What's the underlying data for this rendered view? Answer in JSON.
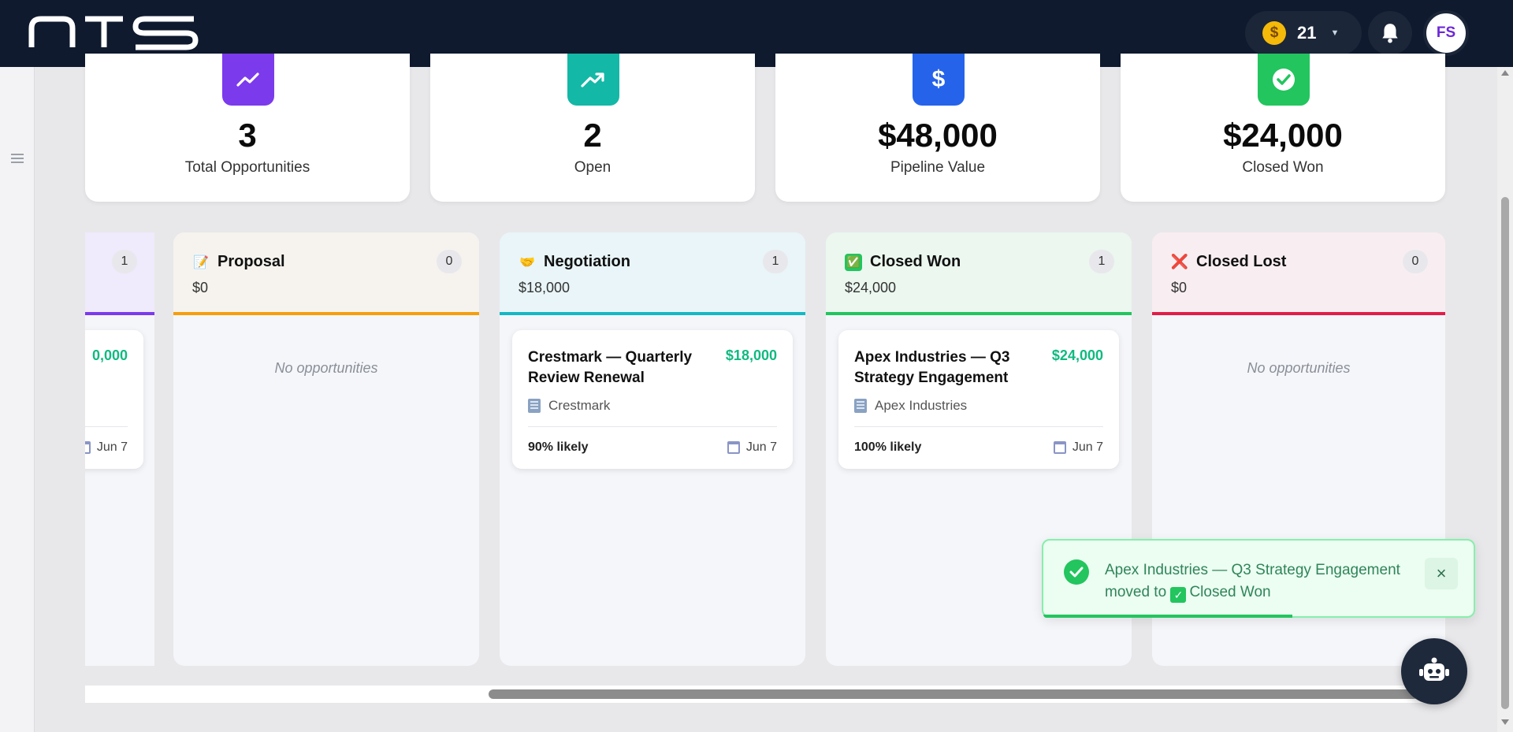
{
  "header": {
    "logo_text": "NTS",
    "credits": "21",
    "avatar_initials": "FS"
  },
  "stats": [
    {
      "value": "3",
      "label": "Total Opportunities",
      "color": "#7c3aed",
      "icon": "trending-up-icon"
    },
    {
      "value": "2",
      "label": "Open",
      "color": "#14b8a6",
      "icon": "trending-up-icon"
    },
    {
      "value": "$48,000",
      "label": "Pipeline Value",
      "color": "#2563eb",
      "icon": "dollar-icon"
    },
    {
      "value": "$24,000",
      "label": "Closed Won",
      "color": "#22c55e",
      "icon": "check-circle-icon"
    }
  ],
  "pipeline": {
    "partial_column": {
      "count": "1",
      "card_amount": "0,000",
      "card_date": "Jun 7",
      "color": "#7c3aed"
    },
    "columns": [
      {
        "name": "Proposal",
        "emoji": "📝",
        "total": "$0",
        "count": "0",
        "color": "#f59e0b",
        "head_bg": "#f6f3ee",
        "empty_text": "No opportunities"
      },
      {
        "name": "Negotiation",
        "emoji": "🤝",
        "total": "$18,000",
        "count": "1",
        "color": "#14b8c4",
        "head_bg": "#e9f5f8",
        "card": {
          "title": "Crestmark — Quarterly Review Renewal",
          "amount": "$18,000",
          "company": "Crestmark",
          "likely": "90% likely",
          "date": "Jun 7"
        }
      },
      {
        "name": "Closed Won",
        "emoji": "✅",
        "total": "$24,000",
        "count": "1",
        "color": "#22c55e",
        "head_bg": "#ebf7ef",
        "card": {
          "title": "Apex Industries — Q3 Strategy Engagement",
          "amount": "$24,000",
          "company": "Apex Industries",
          "likely": "100% likely",
          "date": "Jun 7"
        }
      },
      {
        "name": "Closed Lost",
        "emoji": "❌",
        "total": "$0",
        "count": "0",
        "color": "#e11d48",
        "head_bg": "#f8eef1",
        "empty_text": "No opportunities"
      }
    ]
  },
  "toast": {
    "message_part1": "Apex Industries — Q3 Strategy Engagement moved to",
    "message_part2": "Closed Won",
    "close_label": "×"
  }
}
